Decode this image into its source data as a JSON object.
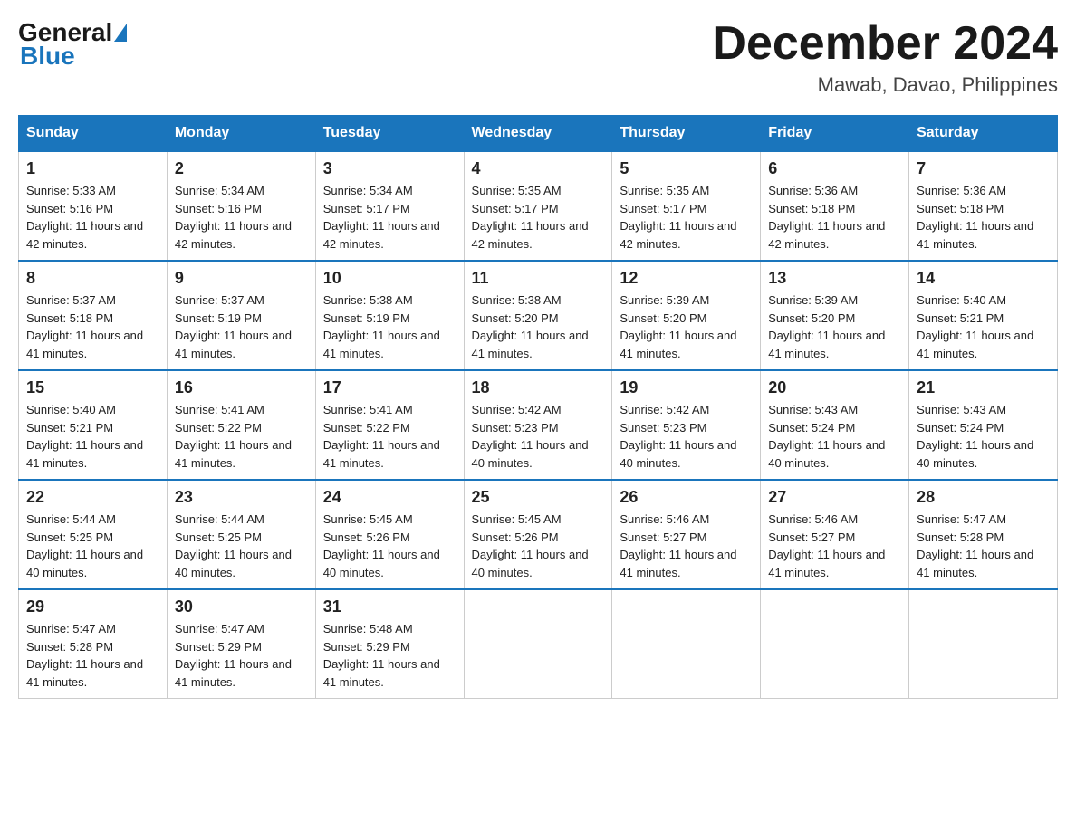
{
  "logo": {
    "general": "General",
    "blue": "Blue"
  },
  "title": {
    "month_year": "December 2024",
    "location": "Mawab, Davao, Philippines"
  },
  "headers": [
    "Sunday",
    "Monday",
    "Tuesday",
    "Wednesday",
    "Thursday",
    "Friday",
    "Saturday"
  ],
  "weeks": [
    [
      {
        "day": "1",
        "sunrise": "5:33 AM",
        "sunset": "5:16 PM",
        "daylight": "11 hours and 42 minutes."
      },
      {
        "day": "2",
        "sunrise": "5:34 AM",
        "sunset": "5:16 PM",
        "daylight": "11 hours and 42 minutes."
      },
      {
        "day": "3",
        "sunrise": "5:34 AM",
        "sunset": "5:17 PM",
        "daylight": "11 hours and 42 minutes."
      },
      {
        "day": "4",
        "sunrise": "5:35 AM",
        "sunset": "5:17 PM",
        "daylight": "11 hours and 42 minutes."
      },
      {
        "day": "5",
        "sunrise": "5:35 AM",
        "sunset": "5:17 PM",
        "daylight": "11 hours and 42 minutes."
      },
      {
        "day": "6",
        "sunrise": "5:36 AM",
        "sunset": "5:18 PM",
        "daylight": "11 hours and 42 minutes."
      },
      {
        "day": "7",
        "sunrise": "5:36 AM",
        "sunset": "5:18 PM",
        "daylight": "11 hours and 41 minutes."
      }
    ],
    [
      {
        "day": "8",
        "sunrise": "5:37 AM",
        "sunset": "5:18 PM",
        "daylight": "11 hours and 41 minutes."
      },
      {
        "day": "9",
        "sunrise": "5:37 AM",
        "sunset": "5:19 PM",
        "daylight": "11 hours and 41 minutes."
      },
      {
        "day": "10",
        "sunrise": "5:38 AM",
        "sunset": "5:19 PM",
        "daylight": "11 hours and 41 minutes."
      },
      {
        "day": "11",
        "sunrise": "5:38 AM",
        "sunset": "5:20 PM",
        "daylight": "11 hours and 41 minutes."
      },
      {
        "day": "12",
        "sunrise": "5:39 AM",
        "sunset": "5:20 PM",
        "daylight": "11 hours and 41 minutes."
      },
      {
        "day": "13",
        "sunrise": "5:39 AM",
        "sunset": "5:20 PM",
        "daylight": "11 hours and 41 minutes."
      },
      {
        "day": "14",
        "sunrise": "5:40 AM",
        "sunset": "5:21 PM",
        "daylight": "11 hours and 41 minutes."
      }
    ],
    [
      {
        "day": "15",
        "sunrise": "5:40 AM",
        "sunset": "5:21 PM",
        "daylight": "11 hours and 41 minutes."
      },
      {
        "day": "16",
        "sunrise": "5:41 AM",
        "sunset": "5:22 PM",
        "daylight": "11 hours and 41 minutes."
      },
      {
        "day": "17",
        "sunrise": "5:41 AM",
        "sunset": "5:22 PM",
        "daylight": "11 hours and 41 minutes."
      },
      {
        "day": "18",
        "sunrise": "5:42 AM",
        "sunset": "5:23 PM",
        "daylight": "11 hours and 40 minutes."
      },
      {
        "day": "19",
        "sunrise": "5:42 AM",
        "sunset": "5:23 PM",
        "daylight": "11 hours and 40 minutes."
      },
      {
        "day": "20",
        "sunrise": "5:43 AM",
        "sunset": "5:24 PM",
        "daylight": "11 hours and 40 minutes."
      },
      {
        "day": "21",
        "sunrise": "5:43 AM",
        "sunset": "5:24 PM",
        "daylight": "11 hours and 40 minutes."
      }
    ],
    [
      {
        "day": "22",
        "sunrise": "5:44 AM",
        "sunset": "5:25 PM",
        "daylight": "11 hours and 40 minutes."
      },
      {
        "day": "23",
        "sunrise": "5:44 AM",
        "sunset": "5:25 PM",
        "daylight": "11 hours and 40 minutes."
      },
      {
        "day": "24",
        "sunrise": "5:45 AM",
        "sunset": "5:26 PM",
        "daylight": "11 hours and 40 minutes."
      },
      {
        "day": "25",
        "sunrise": "5:45 AM",
        "sunset": "5:26 PM",
        "daylight": "11 hours and 40 minutes."
      },
      {
        "day": "26",
        "sunrise": "5:46 AM",
        "sunset": "5:27 PM",
        "daylight": "11 hours and 41 minutes."
      },
      {
        "day": "27",
        "sunrise": "5:46 AM",
        "sunset": "5:27 PM",
        "daylight": "11 hours and 41 minutes."
      },
      {
        "day": "28",
        "sunrise": "5:47 AM",
        "sunset": "5:28 PM",
        "daylight": "11 hours and 41 minutes."
      }
    ],
    [
      {
        "day": "29",
        "sunrise": "5:47 AM",
        "sunset": "5:28 PM",
        "daylight": "11 hours and 41 minutes."
      },
      {
        "day": "30",
        "sunrise": "5:47 AM",
        "sunset": "5:29 PM",
        "daylight": "11 hours and 41 minutes."
      },
      {
        "day": "31",
        "sunrise": "5:48 AM",
        "sunset": "5:29 PM",
        "daylight": "11 hours and 41 minutes."
      },
      null,
      null,
      null,
      null
    ]
  ]
}
